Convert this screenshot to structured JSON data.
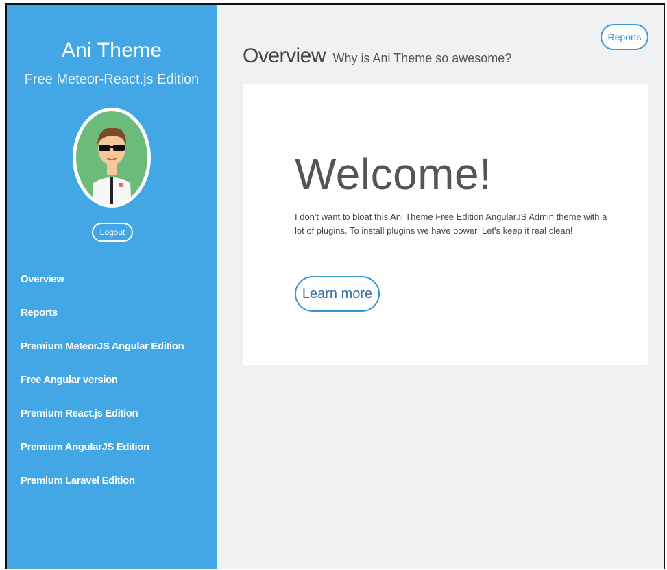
{
  "sidebar": {
    "title": "Ani Theme",
    "subtitle": "Free Meteor-React.js Edition",
    "avatar_icon": "developer-avatar-icon",
    "logout_label": "Logout",
    "nav": [
      {
        "label": "Overview"
      },
      {
        "label": "Reports"
      },
      {
        "label": "Premium MeteorJS Angular Edition"
      },
      {
        "label": "Free Angular version"
      },
      {
        "label": "Premium React.js Edition"
      },
      {
        "label": "Premium AngularJS Edition"
      },
      {
        "label": "Premium Laravel Edition"
      }
    ]
  },
  "header": {
    "title": "Overview",
    "subtitle": "Why is Ani Theme so awesome?",
    "reports_button": "Reports"
  },
  "card": {
    "heading": "Welcome!",
    "body": "I don't want to bloat this Ani Theme Free Edition AngularJS Admin theme with a lot of plugins. To install plugins we have bower. Let's keep it real clean!",
    "button_label": "Learn more"
  },
  "colors": {
    "sidebar_bg": "#42a7e4",
    "main_bg": "#eff1f3",
    "accent": "#3a95d4"
  }
}
